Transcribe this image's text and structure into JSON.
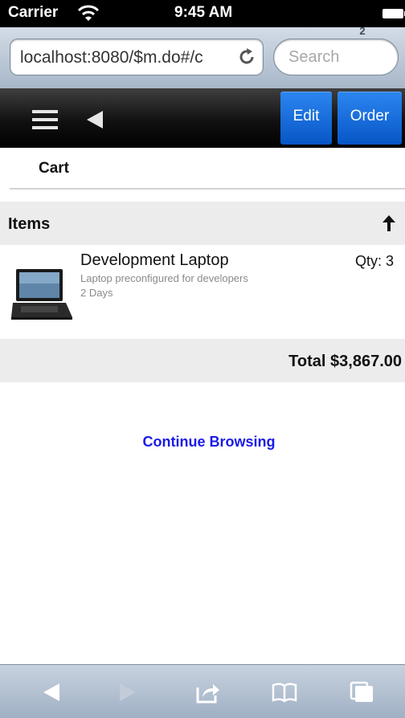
{
  "status_bar": {
    "carrier": "Carrier",
    "time": "9:45 AM"
  },
  "browser": {
    "url": "localhost:8080/$m.do#/c",
    "search_placeholder": "Search",
    "tabs_count": "2"
  },
  "toolbar": {
    "edit_label": "Edit",
    "order_label": "Order"
  },
  "page": {
    "title": "Cart"
  },
  "items_section": {
    "header": "Items",
    "items": [
      {
        "name": "Development Laptop",
        "description": "Laptop preconfigured for developers",
        "duration": "2 Days",
        "quantity": "Qty: 3"
      }
    ]
  },
  "total": "Total $3,867.00",
  "continue_browsing": "Continue Browsing",
  "colors": {
    "accent_blue": "#0a63d6",
    "link_blue": "#1a1ae6",
    "section_bg": "#ececec"
  }
}
